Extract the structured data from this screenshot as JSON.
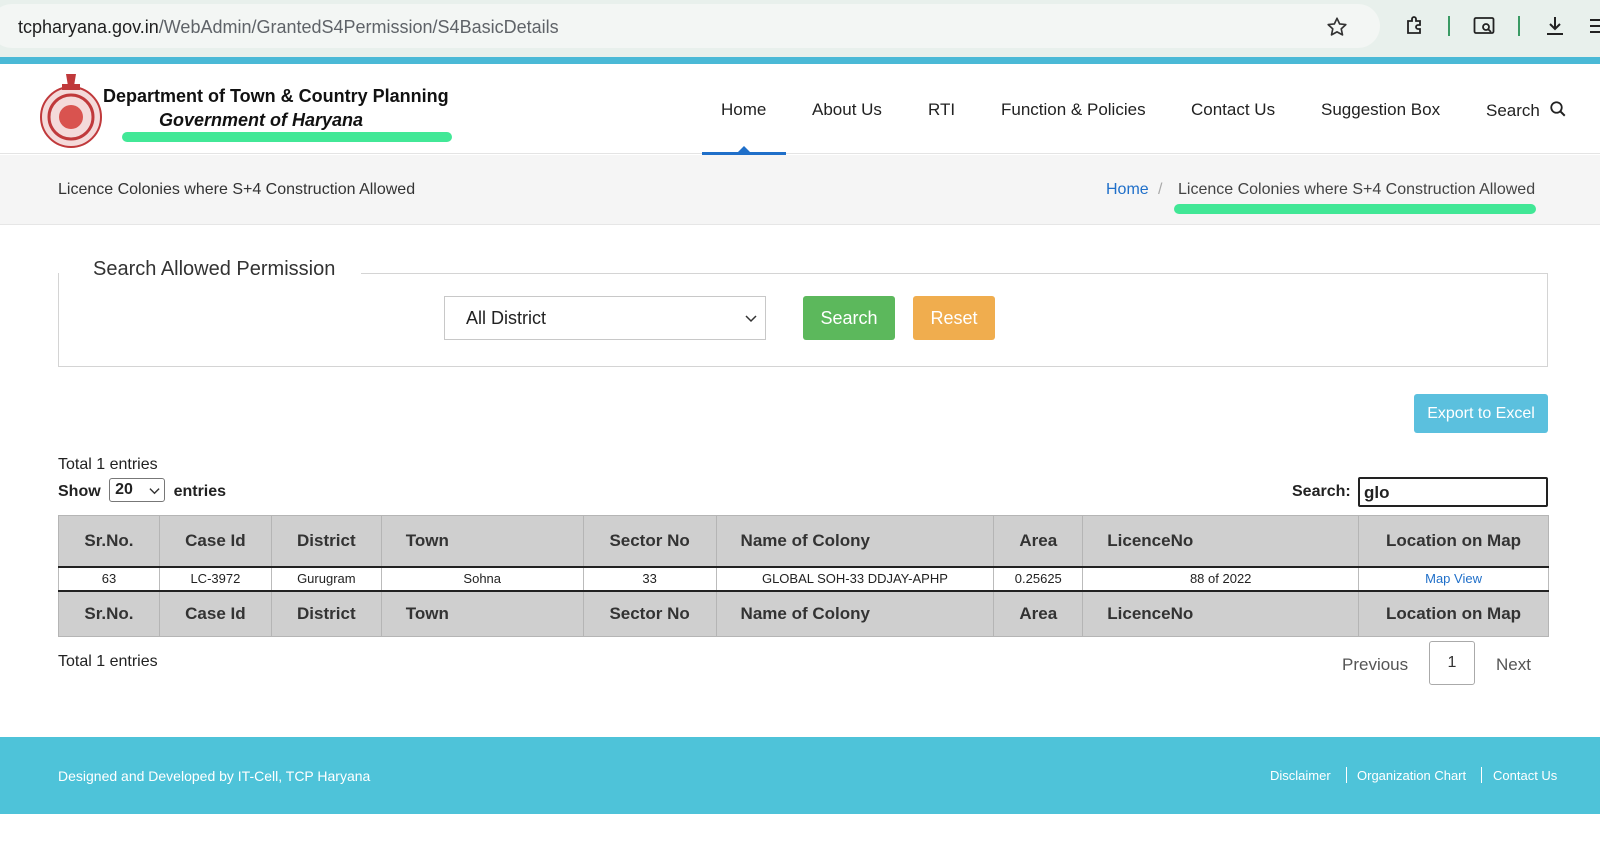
{
  "browser": {
    "url_host": "tcpharyana.gov.in",
    "url_path": "/WebAdmin/GrantedS4Permission/S4BasicDetails"
  },
  "header": {
    "dept_name": "Department of Town & Country Planning",
    "gov_name": "Government of Haryana",
    "nav": [
      "Home",
      "About Us",
      "RTI",
      "Function & Policies",
      "Contact Us",
      "Suggestion Box",
      "Search"
    ]
  },
  "breadcrumb": {
    "title": "Licence Colonies where S+4 Construction Allowed",
    "home": "Home",
    "separator": "/",
    "current": "Licence Colonies where S+4 Construction Allowed"
  },
  "search_box": {
    "legend": "Search Allowed Permission",
    "district_selected": "All District",
    "search_label": "Search",
    "reset_label": "Reset"
  },
  "export_label": "Export to Excel",
  "table_controls": {
    "total_top": "Total 1 entries",
    "show_label": "Show",
    "show_value": "20",
    "entries_label": "entries",
    "search_label": "Search:",
    "search_value": "glo"
  },
  "table": {
    "headers": [
      "Sr.No.",
      "Case Id",
      "District",
      "Town",
      "Sector No",
      "Name of Colony",
      "Area",
      "LicenceNo",
      "Location on Map"
    ],
    "rows": [
      [
        "63",
        "LC-3972",
        "Gurugram",
        "Sohna",
        "33",
        "GLOBAL SOH-33 DDJAY-APHP",
        "0.25625",
        "88 of 2022",
        "Map View"
      ]
    ]
  },
  "pagination": {
    "total_bottom": "Total 1 entries",
    "previous": "Previous",
    "page": "1",
    "next": "Next"
  },
  "footer": {
    "credit": "Designed and Developed by IT-Cell, TCP Haryana",
    "links": [
      "Disclaimer",
      "Organization Chart",
      "Contact Us"
    ]
  },
  "colors": {
    "accent_blue": "#4ab9d6",
    "footer": "#4ec3d9",
    "success": "#5cb85c",
    "warning": "#f0ad4e",
    "info": "#5bc0de",
    "highlight": "#2de68c"
  }
}
